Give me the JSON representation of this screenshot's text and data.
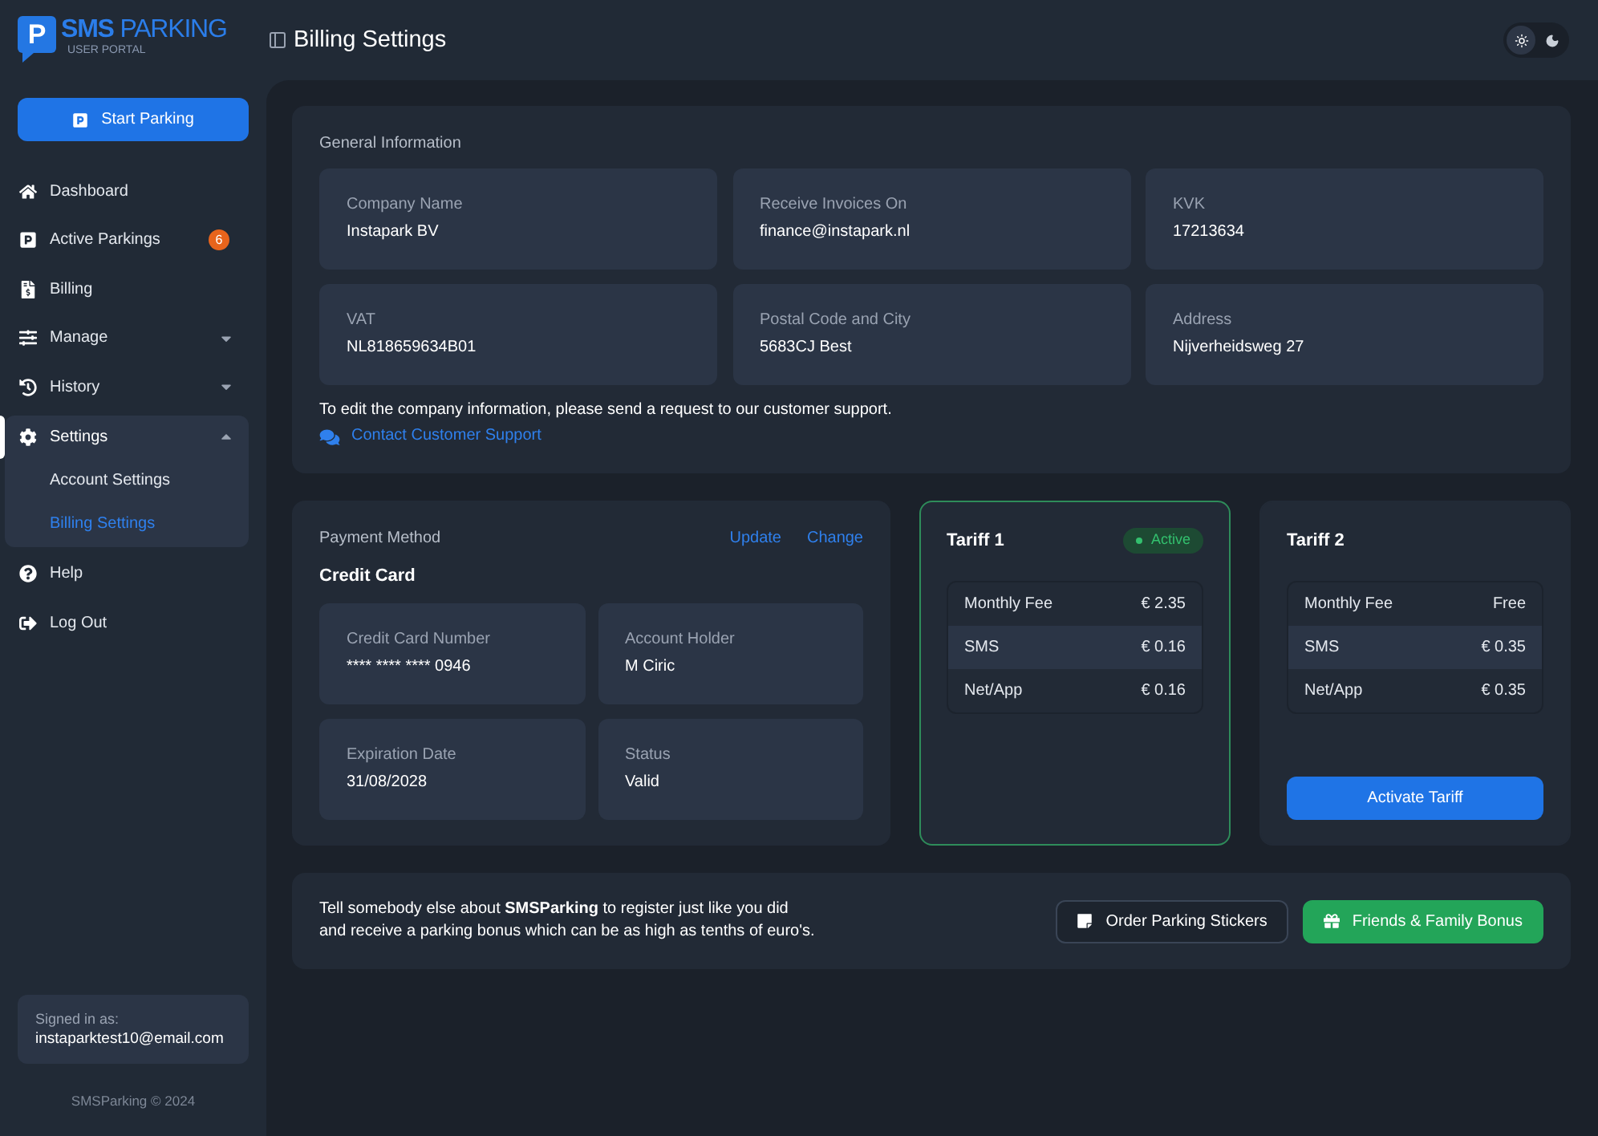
{
  "logo": {
    "mark": "P",
    "name": "**SMS** PARKING",
    "tagline": "USER PORTAL"
  },
  "header": {
    "title": "Billing Settings",
    "theme_options": [
      {
        "kind": "light",
        "selected": true
      },
      {
        "kind": "dark",
        "selected": false
      }
    ]
  },
  "sidebar": {
    "start_button": "Start Parking",
    "items": [
      {
        "kind": "link",
        "label": "Dashboard",
        "selected": false
      },
      {
        "kind": "link",
        "label": "Active Parkings",
        "badge": "6",
        "selected": false
      },
      {
        "kind": "link",
        "label": "Billing",
        "selected": false
      },
      {
        "kind": "group",
        "label": "Manage",
        "selected": false,
        "expanded": false
      },
      {
        "kind": "group",
        "label": "History",
        "selected": false,
        "expanded": false
      },
      {
        "kind": "group",
        "label": "Settings",
        "selected": true,
        "expanded": true,
        "children": [
          {
            "label": "Account Settings",
            "selected": false
          },
          {
            "label": "Billing Settings",
            "selected": true
          }
        ]
      },
      {
        "kind": "link",
        "label": "Help",
        "selected": false
      },
      {
        "kind": "link",
        "label": "Log Out",
        "selected": false
      }
    ],
    "account": {
      "label": "Signed in as:",
      "email": "instaparktest10@email.com"
    },
    "footer": "SMSParking © 2024"
  },
  "general_information": {
    "title": "General Information",
    "fields": [
      {
        "label": "Company Name",
        "value": "Instapark BV"
      },
      {
        "label": "Receive Invoices On",
        "value": "finance@instapark.nl"
      },
      {
        "label": "KVK",
        "value": "17213634"
      },
      {
        "label": "VAT",
        "value": "NL818659634B01"
      },
      {
        "label": "Postal Code and City",
        "value": "5683CJ Best"
      },
      {
        "label": "Address",
        "value": "Nijverheidsweg 27"
      }
    ],
    "note": "To edit the company information, please send a request to our customer support.",
    "link": "Contact Customer Support"
  },
  "payment_method": {
    "title": "Payment Method",
    "actions": [
      "Update",
      "Change"
    ],
    "type": "Credit Card",
    "fields": [
      {
        "label": "Credit Card Number",
        "value": "**** **** **** 0946"
      },
      {
        "label": "Account Holder",
        "value": "M Ciric"
      },
      {
        "label": "Expiration Date",
        "value": "31/08/2028"
      },
      {
        "label": "Status",
        "value": "Valid"
      }
    ]
  },
  "tariffs": [
    {
      "name": "Tariff 1",
      "active": true,
      "badge": "Active",
      "rows": [
        {
          "label": "Monthly Fee",
          "value": "€ 2.35"
        },
        {
          "label": "SMS",
          "value": "€ 0.16"
        },
        {
          "label": "Net/App",
          "value": "€ 0.16"
        }
      ]
    },
    {
      "name": "Tariff 2",
      "active": false,
      "button": "Activate Tariff",
      "rows": [
        {
          "label": "Monthly Fee",
          "value": "Free"
        },
        {
          "label": "SMS",
          "value": "€ 0.35"
        },
        {
          "label": "Net/App",
          "value": "€ 0.35"
        }
      ]
    }
  ],
  "referral": {
    "text": "Tell somebody else about **SMSParking** to register just like you did\nand receive a parking bonus which can be as high as tenths of euro's.",
    "buttons": [
      {
        "kind": "outline",
        "label": "Order Parking Stickers"
      },
      {
        "kind": "success",
        "label": "Friends & Family Bonus"
      }
    ]
  }
}
